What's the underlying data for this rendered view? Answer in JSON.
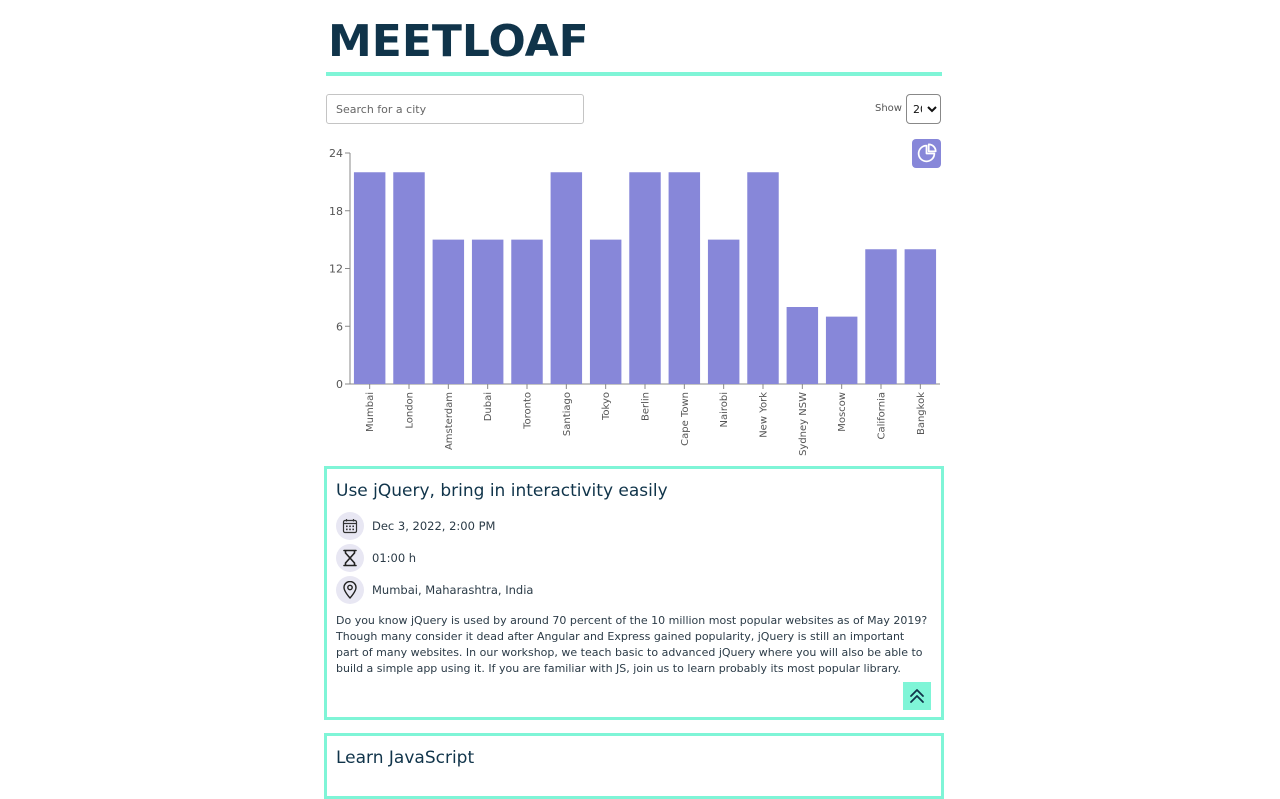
{
  "app": {
    "title": "MEETLOAF"
  },
  "search": {
    "placeholder": "Search for a city",
    "value": ""
  },
  "show": {
    "label": "Show",
    "selected": "20",
    "options": [
      "20"
    ]
  },
  "chart_toggle": {
    "icon": "pie-chart-icon"
  },
  "colors": {
    "accent": "#7ff5d7",
    "bar": "#8787d9",
    "title": "#10344a"
  },
  "chart_data": {
    "type": "bar",
    "categories": [
      "Mumbai",
      "London",
      "Amsterdam",
      "Dubai",
      "Toronto",
      "Santiago",
      "Tokyo",
      "Berlin",
      "Cape Town",
      "Nairobi",
      "New York",
      "Sydney NSW",
      "Moscow",
      "California",
      "Bangkok"
    ],
    "values": [
      22,
      22,
      15,
      15,
      15,
      22,
      15,
      22,
      22,
      15,
      22,
      8,
      7,
      14,
      14
    ],
    "yticks": [
      0,
      6,
      12,
      18,
      24
    ],
    "ylim": [
      0,
      24
    ],
    "grid": false,
    "title": "",
    "xlabel": "",
    "ylabel": ""
  },
  "events": [
    {
      "title": "Use jQuery, bring in interactivity easily",
      "date": "Dec 3, 2022, 2:00 PM",
      "duration": "01:00 h",
      "location": "Mumbai, Maharashtra, India",
      "description": "Do you know jQuery is used by around 70 percent of the 10 million most popular websites as of May 2019? Though many consider it dead after Angular and Express gained popularity, jQuery is still an important part of many websites. In our workshop, we teach basic to advanced jQuery where you will also be able to build a simple app using it. If you are familiar with JS, join us to learn probably its most popular library.",
      "date_icon": "calendar-icon",
      "duration_icon": "hourglass-icon",
      "location_icon": "map-pin-icon",
      "toggle_icon": "chevron-up-double-icon"
    },
    {
      "title": "Learn JavaScript"
    }
  ]
}
